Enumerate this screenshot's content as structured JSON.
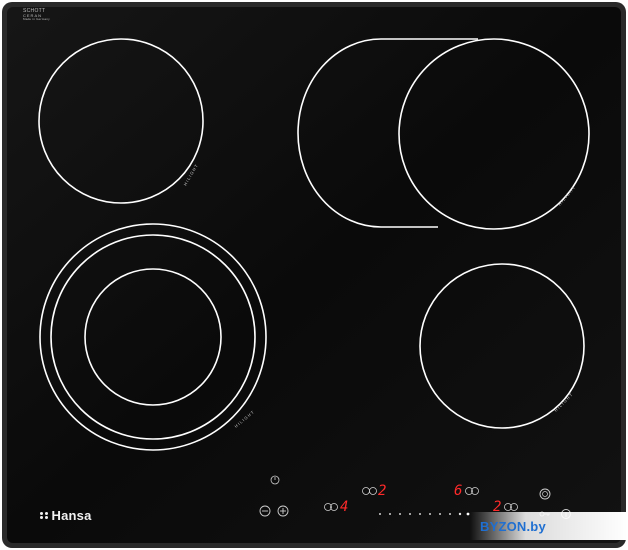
{
  "product": {
    "brand": "Hansa",
    "glass_maker_top": "SCHOTT",
    "glass_maker_mid": "CERAN",
    "glass_maker_bottom": "Made in Germany"
  },
  "zones": {
    "marking": "HILIGHT"
  },
  "controls": {
    "display_left": "4",
    "display_center": "2",
    "display_right_a": "6",
    "display_right_b": "2"
  },
  "watermark": {
    "text": "BYZON.by"
  },
  "colors": {
    "glass": "#0b0b0b",
    "frame": "#2b2b2b",
    "ring": "#ffffff",
    "display": "#ff2a2a",
    "watermark": "#1f6fd1"
  }
}
